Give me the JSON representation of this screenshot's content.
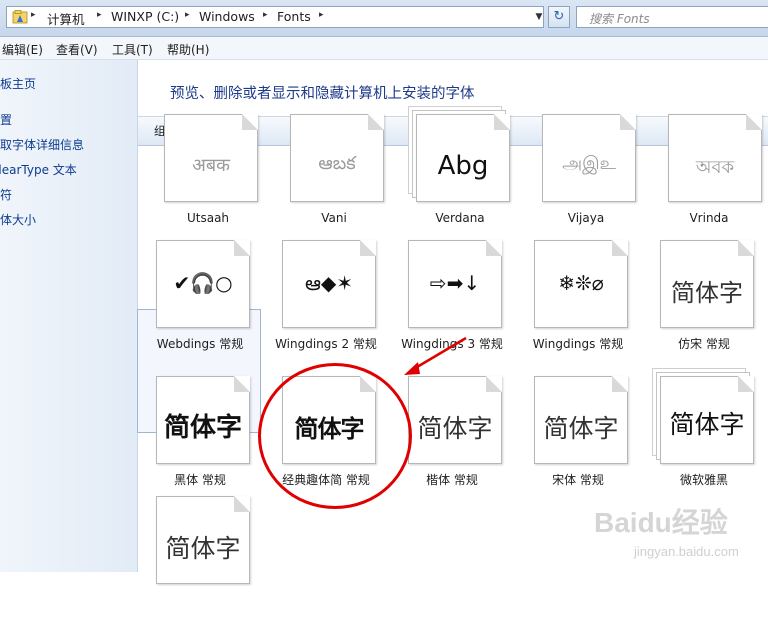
{
  "address_bar": {
    "breadcrumbs": [
      "计算机",
      "WINXP (C:)",
      "Windows",
      "Fonts"
    ],
    "search_placeholder": "搜索 Fonts"
  },
  "menu": [
    "编辑(E)",
    "查看(V)",
    "工具(T)",
    "帮助(H)"
  ],
  "left_pane": {
    "links": [
      "制板主页",
      "设置",
      "获取字体详细信息",
      "ClearType 文本",
      "字符",
      "字体大小"
    ]
  },
  "content": {
    "heading": "预览、删除或者显示和隐藏计算机上安装的字体",
    "toolbar": {
      "organize": "组织 ▾"
    }
  },
  "fonts": [
    {
      "sample": "अबक",
      "label": "Utsaah",
      "faded": true
    },
    {
      "sample": "ఆబక",
      "label": "Vani",
      "faded": true
    },
    {
      "sample": "Abg",
      "label": "Verdana",
      "faded": false
    },
    {
      "sample": "அஇஉ",
      "label": "Vijaya",
      "faded": true
    },
    {
      "sample": "অবক",
      "label": "Vrinda",
      "faded": true
    },
    {
      "sample": "✔🎧○",
      "label": "Webdings 常规"
    },
    {
      "sample": "ఆ◆✶",
      "label": "Wingdings 2 常规"
    },
    {
      "sample": "⇨➡↓",
      "label": "Wingdings 3 常规"
    },
    {
      "sample": "❄❊⌀",
      "label": "Wingdings 常规"
    },
    {
      "sample": "简体字",
      "label": "仿宋 常规"
    },
    {
      "sample": "简体字",
      "label": "黑体 常规"
    },
    {
      "sample": "简体字",
      "label": "经典趣体简 常规"
    },
    {
      "sample": "简体字",
      "label": "楷体 常规"
    },
    {
      "sample": "简体字",
      "label": "宋体 常规"
    },
    {
      "sample": "简体字",
      "label": "微软雅黑"
    },
    {
      "sample": "简体字",
      "label": ""
    }
  ],
  "watermark": {
    "text": "Baidu经验",
    "sub": "jingyan.baidu.com"
  },
  "colors": {
    "highlight": "#e00000",
    "heading": "#1e3b8a"
  }
}
